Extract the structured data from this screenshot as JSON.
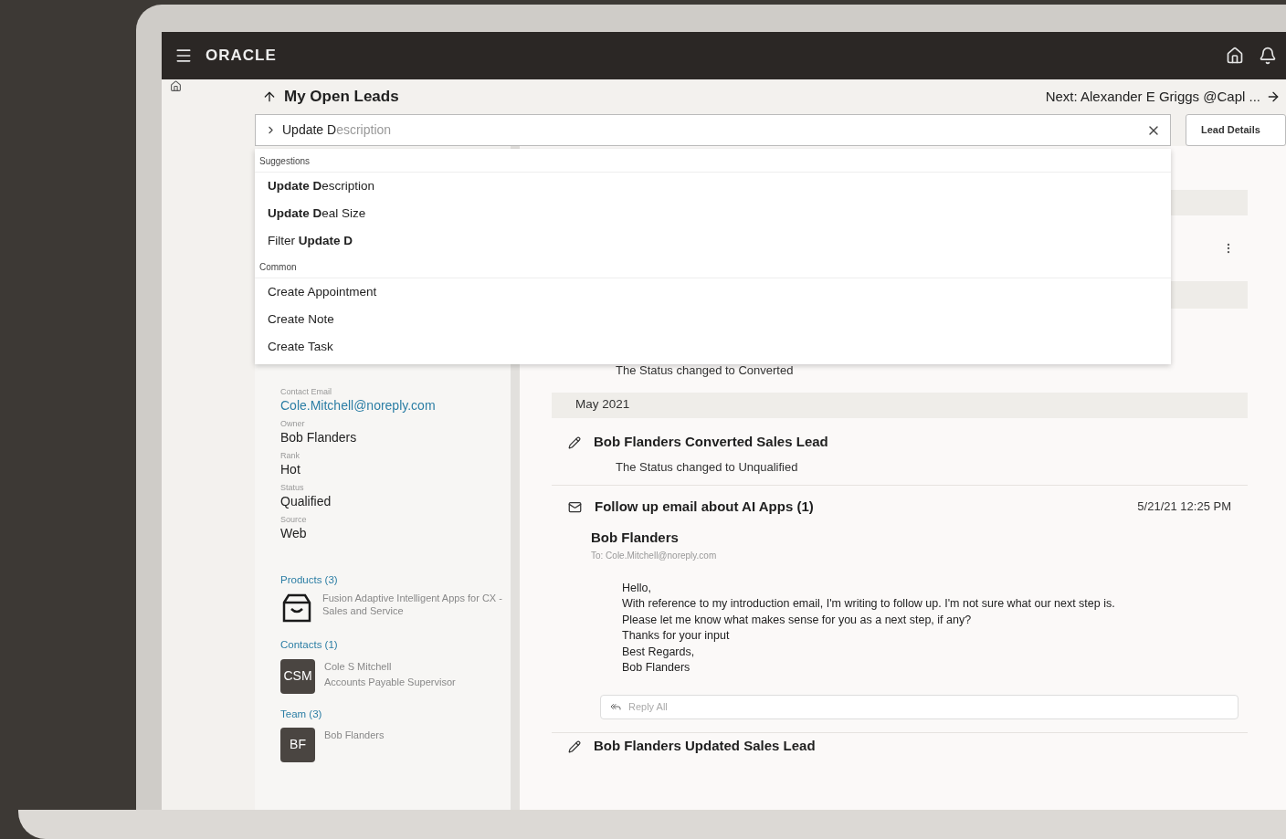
{
  "header": {
    "logo": "ORACLE"
  },
  "title": "My Open Leads",
  "next": "Next: Alexander E Griggs @Capl ...",
  "search": {
    "value": "Update D",
    "completion": "escription"
  },
  "lead_details_button": "Lead Details",
  "dropdown": {
    "groups": [
      {
        "heading": "Suggestions",
        "items": [
          "**Update D**escription",
          "**Update D**eal Size",
          "Filter **Update D**"
        ]
      },
      {
        "heading": "Common",
        "items": [
          "Create Appointment",
          "Create Note",
          "Create Task"
        ]
      }
    ]
  },
  "details": {
    "fields": [
      {
        "label": "Contact Email",
        "value": "Cole.Mitchell@noreply.com",
        "kind": "link"
      },
      {
        "label": "Owner",
        "value": "Bob Flanders",
        "kind": "text"
      },
      {
        "label": "Rank",
        "value": "Hot",
        "kind": "text"
      },
      {
        "label": "Status",
        "value": "Qualified",
        "kind": "text"
      },
      {
        "label": "Source",
        "value": "Web",
        "kind": "text"
      }
    ],
    "products": {
      "heading": "Products (3)",
      "items": [
        {
          "name": "Fusion Adaptive Intelligent Apps for CX - Sales and Service"
        }
      ]
    },
    "contacts": {
      "heading": "Contacts (1)",
      "items": [
        {
          "initials": "CSM",
          "name": "Cole S Mitchell",
          "role": "Accounts Payable Supervisor"
        }
      ]
    },
    "team": {
      "heading": "Team (3)",
      "items": [
        {
          "initials": "BF",
          "name": "Bob Flanders"
        }
      ]
    }
  },
  "timeline": {
    "top_note": "The Status changed to Converted",
    "month": "May 2021",
    "entries": [
      {
        "kind": "edit",
        "title": "Bob Flanders Converted Sales Lead",
        "detail": "The Status changed to Unqualified"
      },
      {
        "kind": "email",
        "title": "Follow up email about AI Apps (1)",
        "time": "5/21/21 12:25 PM",
        "sender": "Bob Flanders",
        "to": "To: Cole.Mitchell@noreply.com",
        "body": [
          "Hello,",
          "With reference to my introduction email, I'm writing to follow up. I'm not sure what our next step is.",
          "Please let me know what makes sense for you as a next step, if any?",
          "Thanks for your input",
          "Best Regards,",
          "Bob Flanders"
        ],
        "reply_placeholder": "Reply All"
      },
      {
        "kind": "edit",
        "title": "Bob Flanders Updated Sales Lead"
      }
    ]
  }
}
